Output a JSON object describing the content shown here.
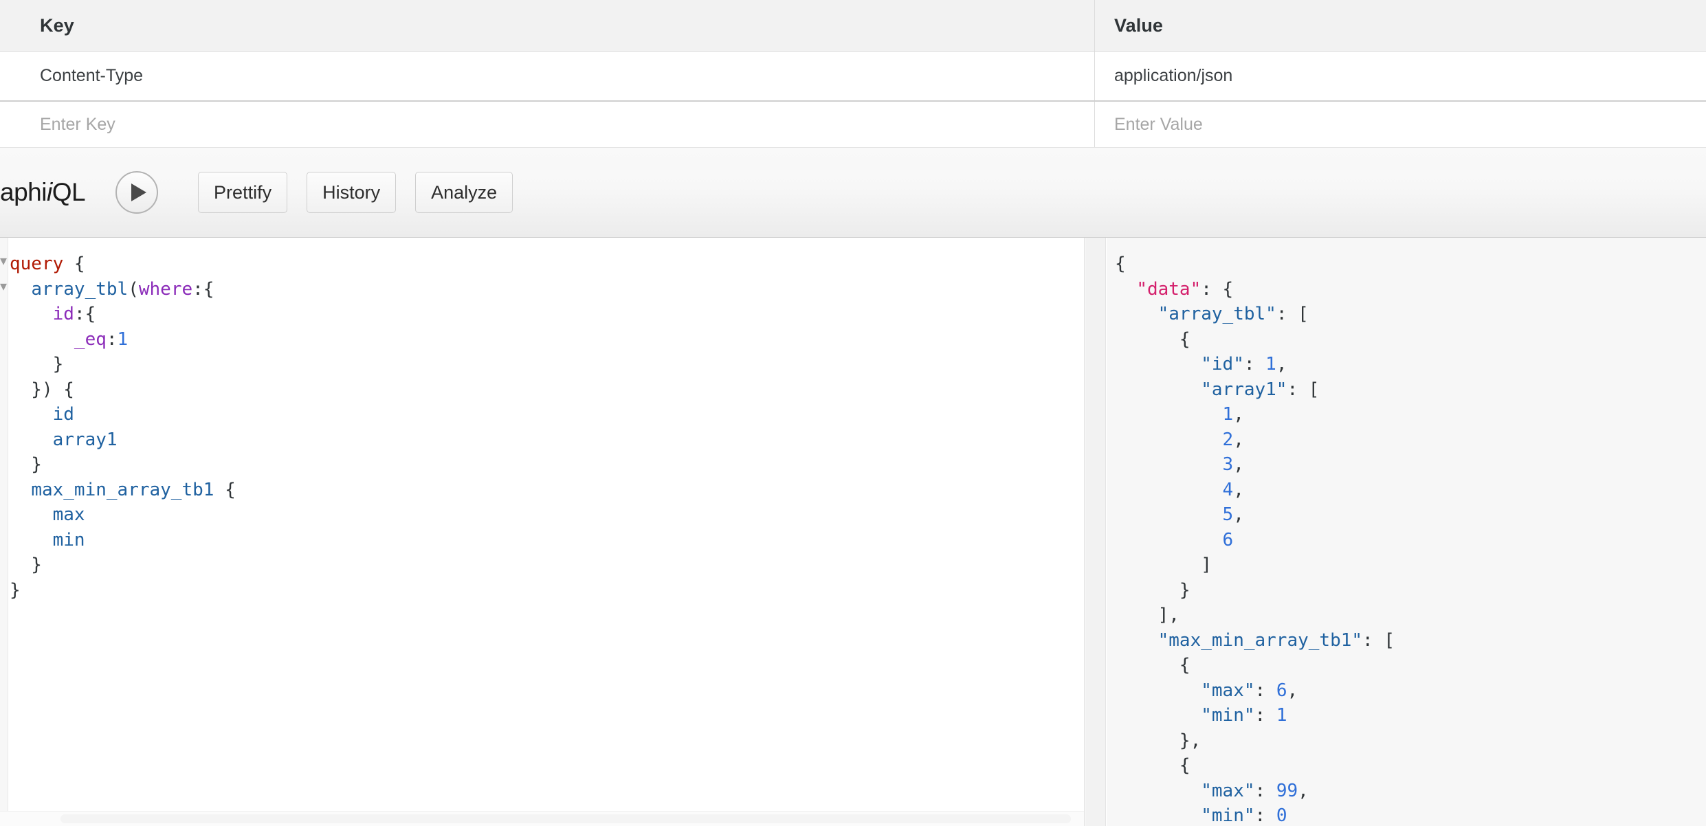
{
  "headers_table": {
    "columns": {
      "key": "Key",
      "value": "Value"
    },
    "rows": [
      {
        "key": "Content-Type",
        "value": "application/json"
      }
    ],
    "new_row": {
      "key_placeholder": "Enter Key",
      "value_placeholder": "Enter Value"
    }
  },
  "toolbar": {
    "logo_visible_text": "aphi",
    "logo_suffix": "QL",
    "execute_icon": "play-icon",
    "buttons": [
      {
        "label": "Prettify"
      },
      {
        "label": "History"
      },
      {
        "label": "Analyze"
      }
    ]
  },
  "query_editor": {
    "lines": [
      [
        {
          "t": "query",
          "c": "q-kw"
        },
        {
          "t": " {",
          "c": "q-punct"
        }
      ],
      [
        {
          "t": "  ",
          "c": "q-punct"
        },
        {
          "t": "array_tbl",
          "c": "q-field"
        },
        {
          "t": "(",
          "c": "q-punct"
        },
        {
          "t": "where",
          "c": "q-arg"
        },
        {
          "t": ":{",
          "c": "q-punct"
        }
      ],
      [
        {
          "t": "    ",
          "c": "q-punct"
        },
        {
          "t": "id",
          "c": "q-arg"
        },
        {
          "t": ":{",
          "c": "q-punct"
        }
      ],
      [
        {
          "t": "      ",
          "c": "q-punct"
        },
        {
          "t": "_eq",
          "c": "q-arg"
        },
        {
          "t": ":",
          "c": "q-punct"
        },
        {
          "t": "1",
          "c": "q-num"
        }
      ],
      [
        {
          "t": "    }",
          "c": "q-punct"
        }
      ],
      [
        {
          "t": "  }) {",
          "c": "q-punct"
        }
      ],
      [
        {
          "t": "    ",
          "c": "q-punct"
        },
        {
          "t": "id",
          "c": "q-field"
        }
      ],
      [
        {
          "t": "    ",
          "c": "q-punct"
        },
        {
          "t": "array1",
          "c": "q-field"
        }
      ],
      [
        {
          "t": "  }",
          "c": "q-punct"
        }
      ],
      [
        {
          "t": "  ",
          "c": "q-punct"
        },
        {
          "t": "max_min_array_tb1",
          "c": "q-field"
        },
        {
          "t": " {",
          "c": "q-punct"
        }
      ],
      [
        {
          "t": "    ",
          "c": "q-punct"
        },
        {
          "t": "max",
          "c": "q-field"
        }
      ],
      [
        {
          "t": "    ",
          "c": "q-punct"
        },
        {
          "t": "min",
          "c": "q-field"
        }
      ],
      [
        {
          "t": "  }",
          "c": "q-punct"
        }
      ],
      [
        {
          "t": "}",
          "c": "q-punct"
        }
      ]
    ]
  },
  "result_viewer": {
    "lines": [
      [
        {
          "t": "{",
          "c": "r-punct"
        }
      ],
      [
        {
          "t": "  ",
          "c": "r-punct"
        },
        {
          "t": "\"data\"",
          "c": "r-data"
        },
        {
          "t": ": {",
          "c": "r-punct"
        }
      ],
      [
        {
          "t": "    ",
          "c": "r-punct"
        },
        {
          "t": "\"array_tbl\"",
          "c": "r-key"
        },
        {
          "t": ": [",
          "c": "r-punct"
        }
      ],
      [
        {
          "t": "      {",
          "c": "r-punct"
        }
      ],
      [
        {
          "t": "        ",
          "c": "r-punct"
        },
        {
          "t": "\"id\"",
          "c": "r-key"
        },
        {
          "t": ": ",
          "c": "r-punct"
        },
        {
          "t": "1",
          "c": "r-num"
        },
        {
          "t": ",",
          "c": "r-punct"
        }
      ],
      [
        {
          "t": "        ",
          "c": "r-punct"
        },
        {
          "t": "\"array1\"",
          "c": "r-key"
        },
        {
          "t": ": [",
          "c": "r-punct"
        }
      ],
      [
        {
          "t": "          ",
          "c": "r-punct"
        },
        {
          "t": "1",
          "c": "r-num"
        },
        {
          "t": ",",
          "c": "r-punct"
        }
      ],
      [
        {
          "t": "          ",
          "c": "r-punct"
        },
        {
          "t": "2",
          "c": "r-num"
        },
        {
          "t": ",",
          "c": "r-punct"
        }
      ],
      [
        {
          "t": "          ",
          "c": "r-punct"
        },
        {
          "t": "3",
          "c": "r-num"
        },
        {
          "t": ",",
          "c": "r-punct"
        }
      ],
      [
        {
          "t": "          ",
          "c": "r-punct"
        },
        {
          "t": "4",
          "c": "r-num"
        },
        {
          "t": ",",
          "c": "r-punct"
        }
      ],
      [
        {
          "t": "          ",
          "c": "r-punct"
        },
        {
          "t": "5",
          "c": "r-num"
        },
        {
          "t": ",",
          "c": "r-punct"
        }
      ],
      [
        {
          "t": "          ",
          "c": "r-punct"
        },
        {
          "t": "6",
          "c": "r-num"
        }
      ],
      [
        {
          "t": "        ]",
          "c": "r-punct"
        }
      ],
      [
        {
          "t": "      }",
          "c": "r-punct"
        }
      ],
      [
        {
          "t": "    ],",
          "c": "r-punct"
        }
      ],
      [
        {
          "t": "    ",
          "c": "r-punct"
        },
        {
          "t": "\"max_min_array_tb1\"",
          "c": "r-key"
        },
        {
          "t": ": [",
          "c": "r-punct"
        }
      ],
      [
        {
          "t": "      {",
          "c": "r-punct"
        }
      ],
      [
        {
          "t": "        ",
          "c": "r-punct"
        },
        {
          "t": "\"max\"",
          "c": "r-key"
        },
        {
          "t": ": ",
          "c": "r-punct"
        },
        {
          "t": "6",
          "c": "r-num"
        },
        {
          "t": ",",
          "c": "r-punct"
        }
      ],
      [
        {
          "t": "        ",
          "c": "r-punct"
        },
        {
          "t": "\"min\"",
          "c": "r-key"
        },
        {
          "t": ": ",
          "c": "r-punct"
        },
        {
          "t": "1",
          "c": "r-num"
        }
      ],
      [
        {
          "t": "      },",
          "c": "r-punct"
        }
      ],
      [
        {
          "t": "      {",
          "c": "r-punct"
        }
      ],
      [
        {
          "t": "        ",
          "c": "r-punct"
        },
        {
          "t": "\"max\"",
          "c": "r-key"
        },
        {
          "t": ": ",
          "c": "r-punct"
        },
        {
          "t": "99",
          "c": "r-num"
        },
        {
          "t": ",",
          "c": "r-punct"
        }
      ],
      [
        {
          "t": "        ",
          "c": "r-punct"
        },
        {
          "t": "\"min\"",
          "c": "r-key"
        },
        {
          "t": ": ",
          "c": "r-punct"
        },
        {
          "t": "0",
          "c": "r-num"
        }
      ]
    ]
  },
  "colors": {
    "keyword": "#b11a04",
    "field": "#1f61a0",
    "argument": "#8b2bb9",
    "number": "#2f6fd8",
    "data_key": "#d4206c",
    "header_bg": "#f2f2f2",
    "result_bg": "#f7f7f7"
  }
}
